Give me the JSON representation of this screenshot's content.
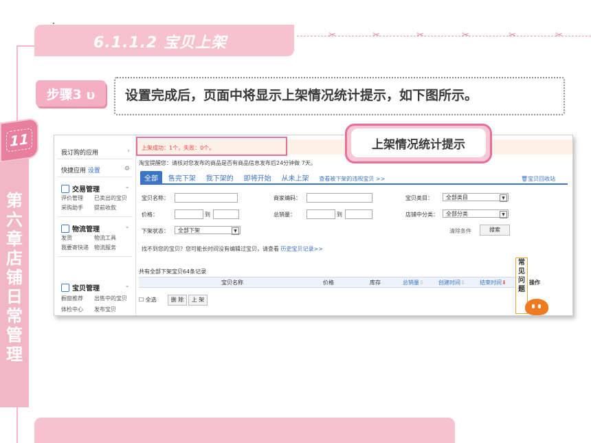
{
  "section": {
    "title": "6.1.1.2  宝贝上架"
  },
  "chapter": {
    "number": "11",
    "title": "第六章 店铺日常管理"
  },
  "step": {
    "label": "步骤3 υ",
    "text": "设置完成后，页面中将显示上架情况统计提示，如下图所示。"
  },
  "callout": {
    "label": "上架情况统计提示"
  },
  "screenshot": {
    "sidebar": {
      "my_apps": "我订购的应用",
      "quick_apps": "快捷应用",
      "settings": "设置",
      "trade": {
        "title": "交易管理",
        "items": [
          "评价管理",
          "已卖出的宝贝",
          "采购助手",
          "提前收款"
        ]
      },
      "logistics": {
        "title": "物流管理",
        "items": [
          "发货",
          "物流工具",
          "我要寄快递",
          "物流服务"
        ]
      },
      "goods": {
        "title": "宝贝管理",
        "items": [
          "橱窗推荐",
          "出售中的宝贝",
          "体检中心",
          "发布宝贝"
        ]
      }
    },
    "notice": "上架成功：1个，失败：0个。",
    "tip": "淘宝提醒您：请核对您发布的商品是否有商品信息发布后24分钟做 7天。",
    "tabs": [
      "全部",
      "售完下架",
      "我下架的",
      "即将开始",
      "从未上架",
      "查看被下架的违规宝贝 >>"
    ],
    "recycle": "宝贝回收站",
    "form": {
      "name_label": "宝贝名称：",
      "merchant_code_label": "商家编码：",
      "category_label": "宝贝类目：",
      "category_value": "全部类目",
      "price_label": "价格：",
      "to1": "到",
      "sales_label": "总销量：",
      "to2": "到",
      "shop_category_label": "店铺中分类：",
      "shop_category_value": "全部分类",
      "status_label": "下架状态：",
      "status_value": "全部下架",
      "clear": "清除条件",
      "search": "搜索"
    },
    "info": "找不到您的宝贝？您可能长时间没有编辑过宝贝，请查看",
    "info_link": "历史宝贝记录>>",
    "total": "共有全部下架宝贝64条记录",
    "table_headers": {
      "name": "宝贝名称",
      "price": "价格",
      "stock": "库存",
      "sales": "总销量",
      "created": "创建时间",
      "ended": "结束时间",
      "ops": "操作"
    },
    "bottom": {
      "select_all": "全选",
      "delete": "删 除",
      "list": "上 架"
    },
    "faq": "常见问题"
  }
}
